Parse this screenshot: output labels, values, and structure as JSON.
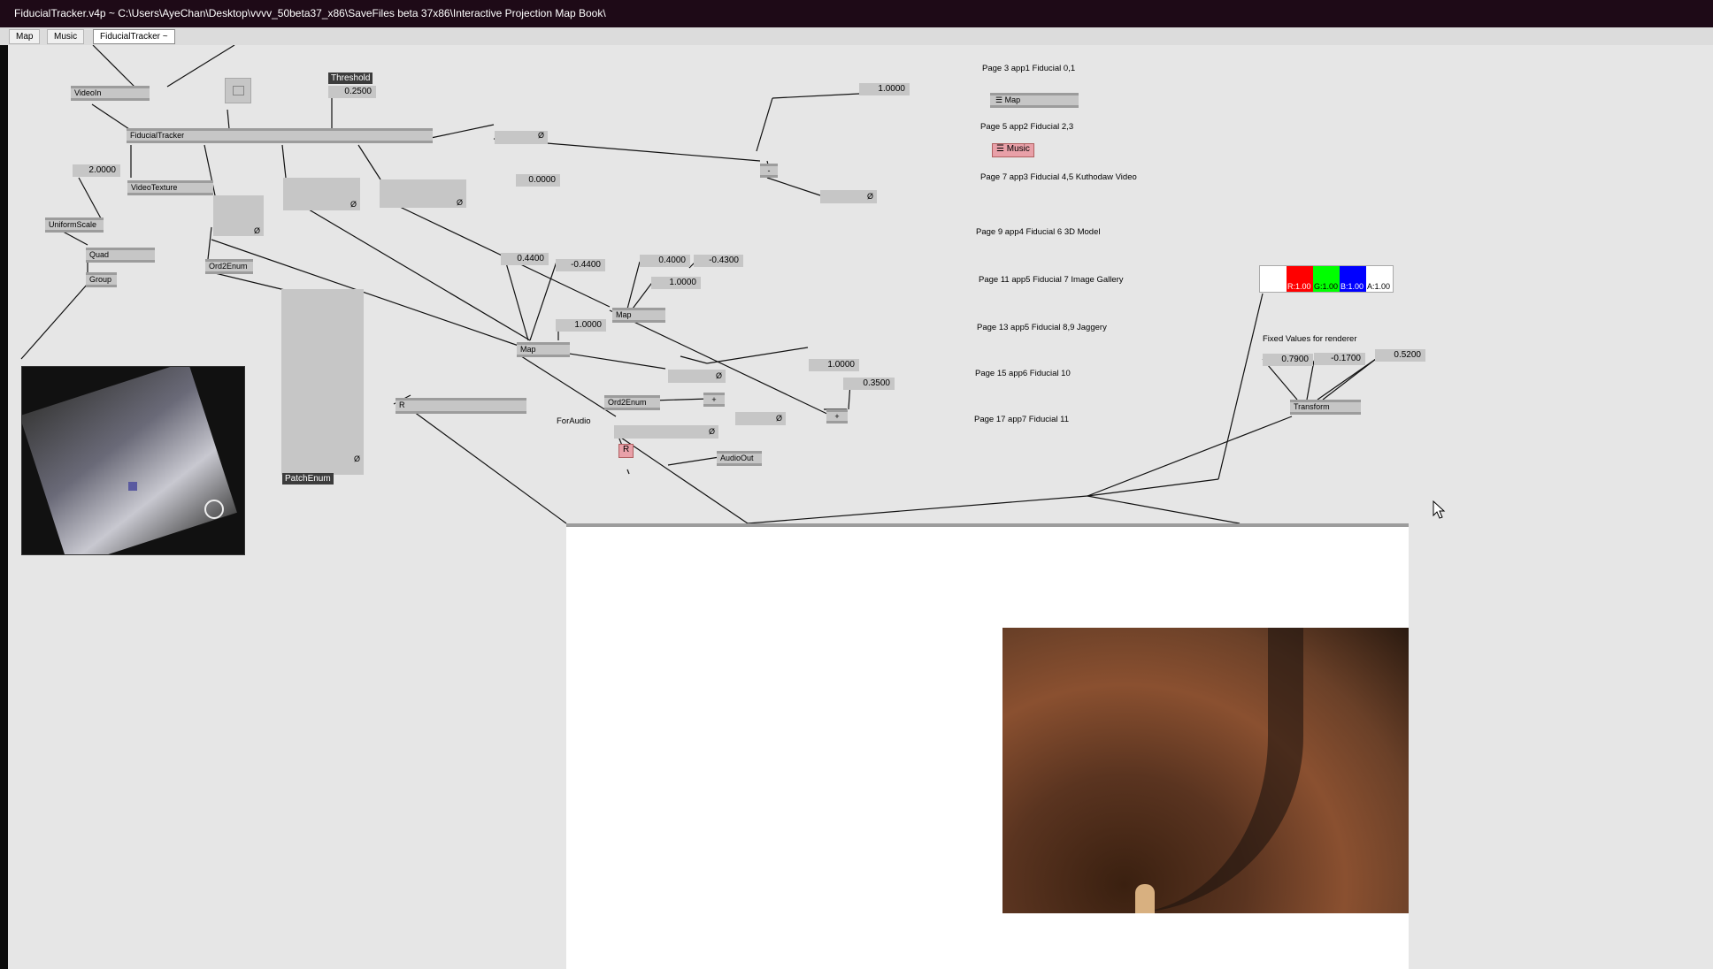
{
  "window": {
    "title": "FiducialTracker.v4p ~  C:\\Users\\AyeChan\\Desktop\\vvvv_50beta37_x86\\SaveFiles beta 37x86\\Interactive Projection Map Book\\"
  },
  "tabs": [
    {
      "label": "Map"
    },
    {
      "label": "Music"
    },
    {
      "label": "FiducialTracker ~"
    }
  ],
  "nodes": {
    "videoin": "VideoIn",
    "fiducialtracker": "FiducialTracker",
    "videotexture": "VideoTexture",
    "uniformscale": "UniformScale",
    "quad": "Quad",
    "group": "Group",
    "ord2enum_1": "Ord2Enum",
    "ord2enum_2": "Ord2Enum",
    "map_1": "Map",
    "map_2": "Map",
    "map_toggle": "Map",
    "music_toggle": "Music",
    "audioout": "AudioOut",
    "transform": "Transform",
    "patchenum": "PatchEnum",
    "threshold": "Threshold",
    "minus": "-",
    "plus_1": "+",
    "plus_2": "+",
    "r_string": "R",
    "r_pink": "R",
    "nil": "Ø"
  },
  "values": {
    "threshold": "0.2500",
    "scale": "2.0000",
    "top_right": "1.0000",
    "zero": "0.0000",
    "v_044": "0.4400",
    "v_m044": "-0.4400",
    "v_04": "0.4000",
    "v_m043": "-0.4300",
    "one_a": "1.0000",
    "one_b": "1.0000",
    "one_c": "1.0000",
    "v_035": "0.3500",
    "fx": "0.7900",
    "fy": "-0.1700",
    "fz": "0.5200"
  },
  "comments": {
    "page3": "Page 3 app1 Fiducial 0,1",
    "page5": "Page 5 app2 Fiducial 2,3",
    "page7": "Page 7 app3 Fiducial 4,5 Kuthodaw Video",
    "page9": "Page 9 app4 Fiducial 6 3D Model",
    "page11": "Page 11 app5 Fiducial 7 Image Gallery",
    "page13": "Page 13 app5 Fiducial 8,9 Jaggery",
    "page15": "Page 15 app6 Fiducial 10",
    "page17": "Page 17 app7 Fiducial 11",
    "fixed": "Fixed Values for renderer",
    "foraudio": "ForAudio"
  },
  "color_box": {
    "r": "R:1.00",
    "g": "G:1.00",
    "b": "B:1.00",
    "a": "A:1.00",
    "colors": {
      "red": "#ff0000",
      "green": "#00ff00",
      "blue": "#0000ff",
      "white": "#ffffff"
    }
  },
  "colors": {
    "titlebar": "#1e0a17",
    "canvas": "#e6e6e6",
    "node": "#c6c6c6",
    "toggle_pink": "#e8a0a8"
  }
}
